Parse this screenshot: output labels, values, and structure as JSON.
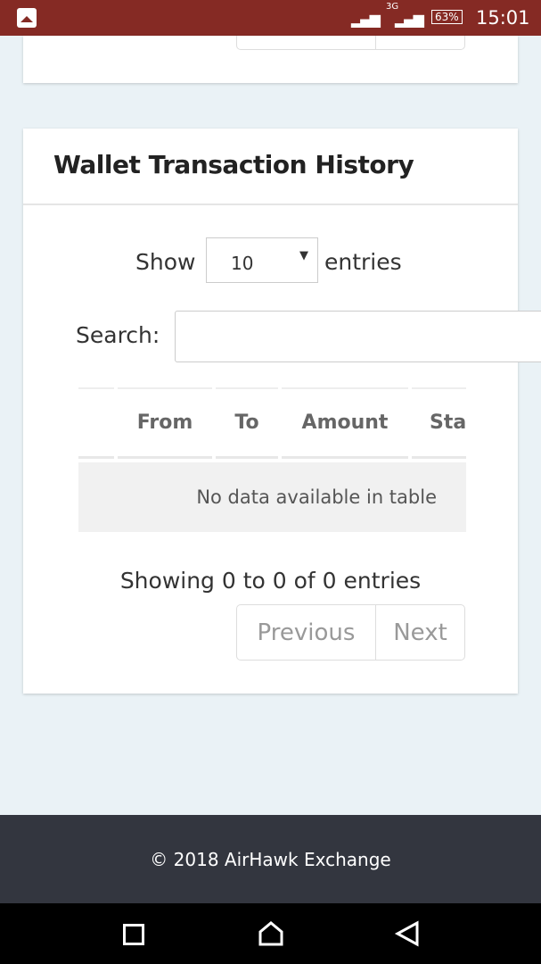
{
  "status_bar": {
    "network": "3G",
    "battery": "63%",
    "time": "15:01"
  },
  "wallet": {
    "title": "Wallet Transaction History",
    "show_label": "Show",
    "entries_label": "entries",
    "page_length": "10",
    "search_label": "Search:",
    "search_value": "",
    "columns": [
      "",
      "From",
      "To",
      "Amount",
      "Sta"
    ],
    "empty_message": "No data available in table",
    "info": "Showing 0 to 0 of 0 entries",
    "previous": "Previous",
    "next": "Next"
  },
  "footer": {
    "text": "© 2018 AirHawk Exchange"
  },
  "colors": {
    "status_bar": "#852a24",
    "footer": "#33363f",
    "background": "#eaf2f6"
  }
}
